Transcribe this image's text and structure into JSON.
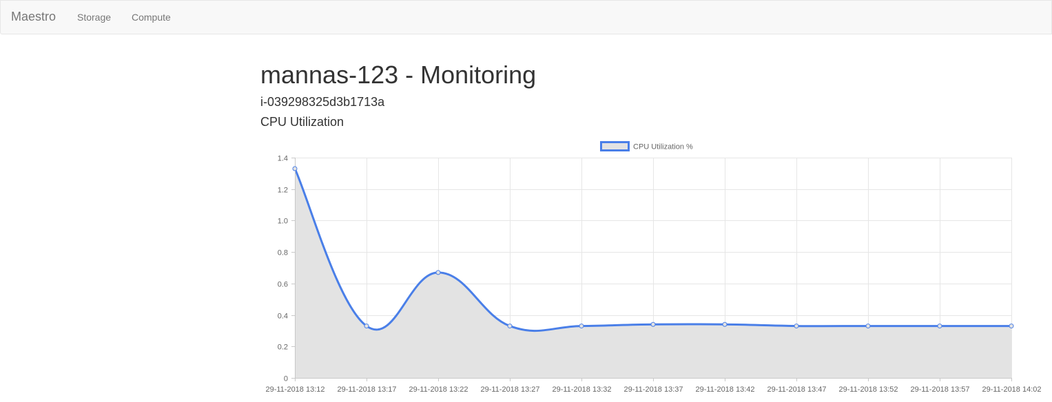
{
  "navbar": {
    "brand": "Maestro",
    "links": [
      {
        "label": "Storage"
      },
      {
        "label": "Compute"
      }
    ]
  },
  "page": {
    "title": "mannas-123 - Monitoring",
    "instance_id": "i-039298325d3b1713a",
    "section_title": "CPU Utilization"
  },
  "colors": {
    "line": "#4a7fe8",
    "fill": "#e3e3e3",
    "grid": "#e6e6e6",
    "axis": "#c8c8c8"
  },
  "chart_data": {
    "type": "area",
    "categories": [
      "29-11-2018 13:12",
      "29-11-2018 13:17",
      "29-11-2018 13:22",
      "29-11-2018 13:27",
      "29-11-2018 13:32",
      "29-11-2018 13:37",
      "29-11-2018 13:42",
      "29-11-2018 13:47",
      "29-11-2018 13:52",
      "29-11-2018 13:57",
      "29-11-2018 14:02"
    ],
    "series": [
      {
        "name": "CPU Utilization %",
        "values": [
          1.33,
          0.33,
          0.67,
          0.33,
          0.33,
          0.34,
          0.34,
          0.33,
          0.33,
          0.33,
          0.33
        ]
      }
    ],
    "ylim": [
      0,
      1.4
    ],
    "yticks": [
      "0",
      "0.2",
      "0.4",
      "0.6",
      "0.8",
      "1.0",
      "1.2",
      "1.4"
    ],
    "grid": true,
    "legend": "top-center"
  }
}
